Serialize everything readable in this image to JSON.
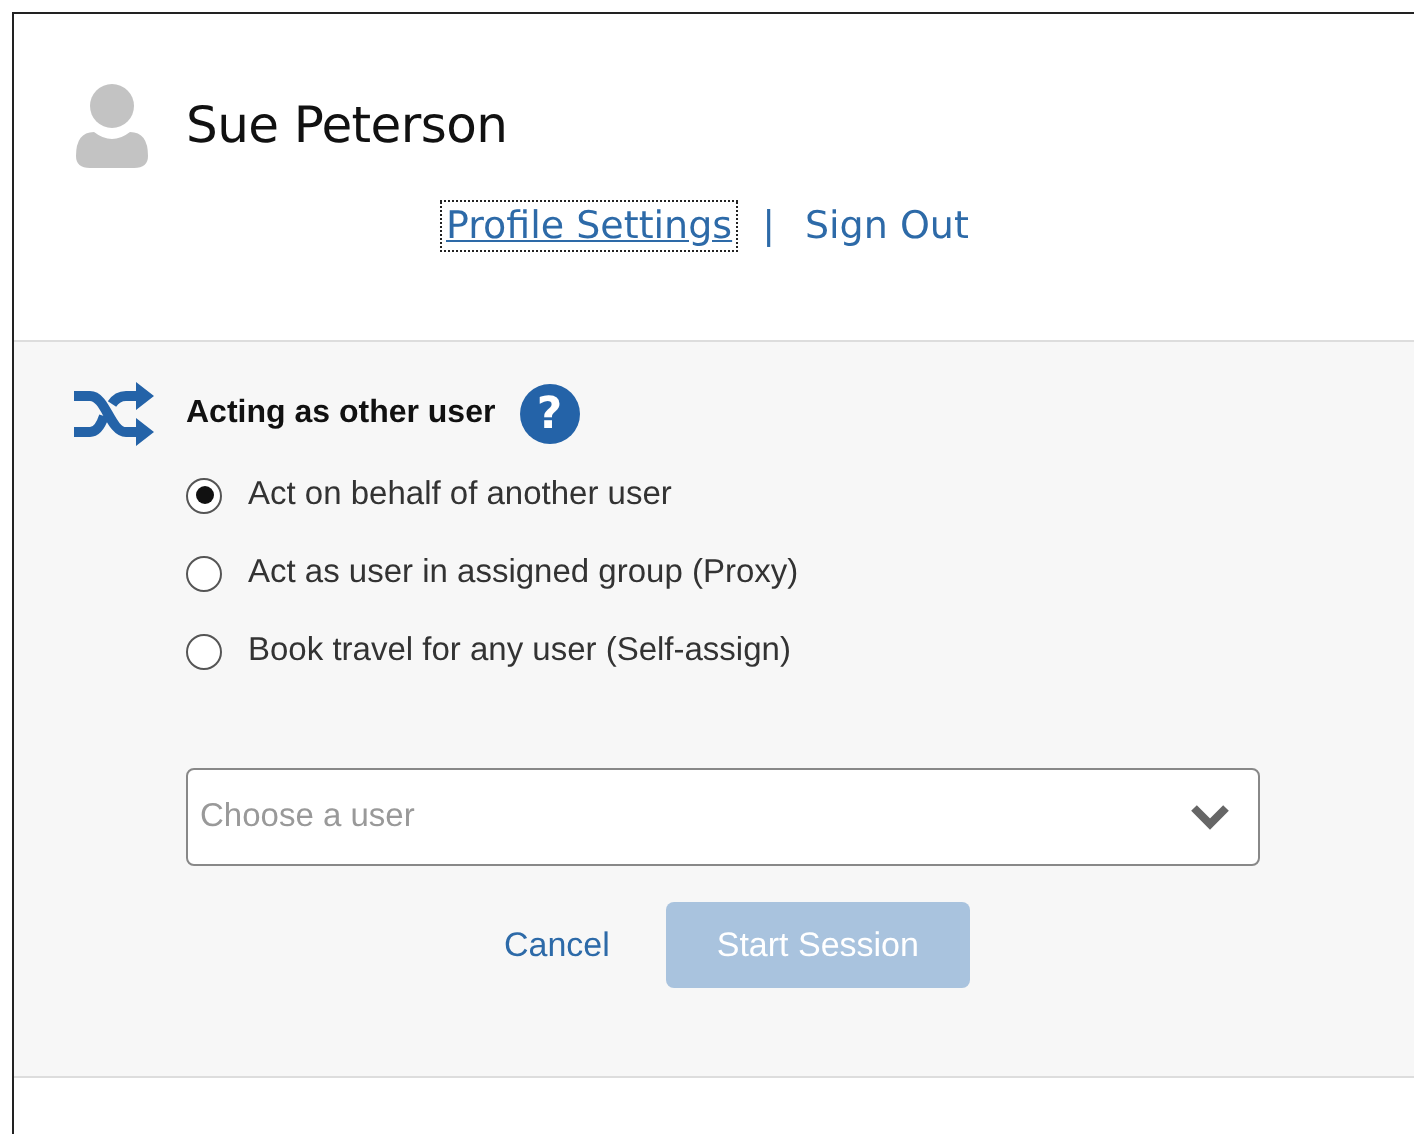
{
  "user": {
    "name": "Sue Peterson"
  },
  "links": [
    {
      "label": "Profile Settings",
      "focused": true
    },
    {
      "label": "Sign Out",
      "focused": false
    }
  ],
  "link_separator": "|",
  "acting": {
    "title": "Acting as other user",
    "help": "?",
    "options": [
      {
        "label": "Act on behalf of another user",
        "selected": true
      },
      {
        "label": "Act as user in assigned group (Proxy)",
        "selected": false
      },
      {
        "label": "Book travel for any user (Self-assign)",
        "selected": false
      }
    ],
    "user_select": {
      "placeholder": "Choose a user"
    },
    "buttons": [
      {
        "kind": "link",
        "label": "Cancel",
        "disabled": false
      },
      {
        "kind": "primary",
        "label": "Start Session",
        "disabled": true
      }
    ]
  }
}
